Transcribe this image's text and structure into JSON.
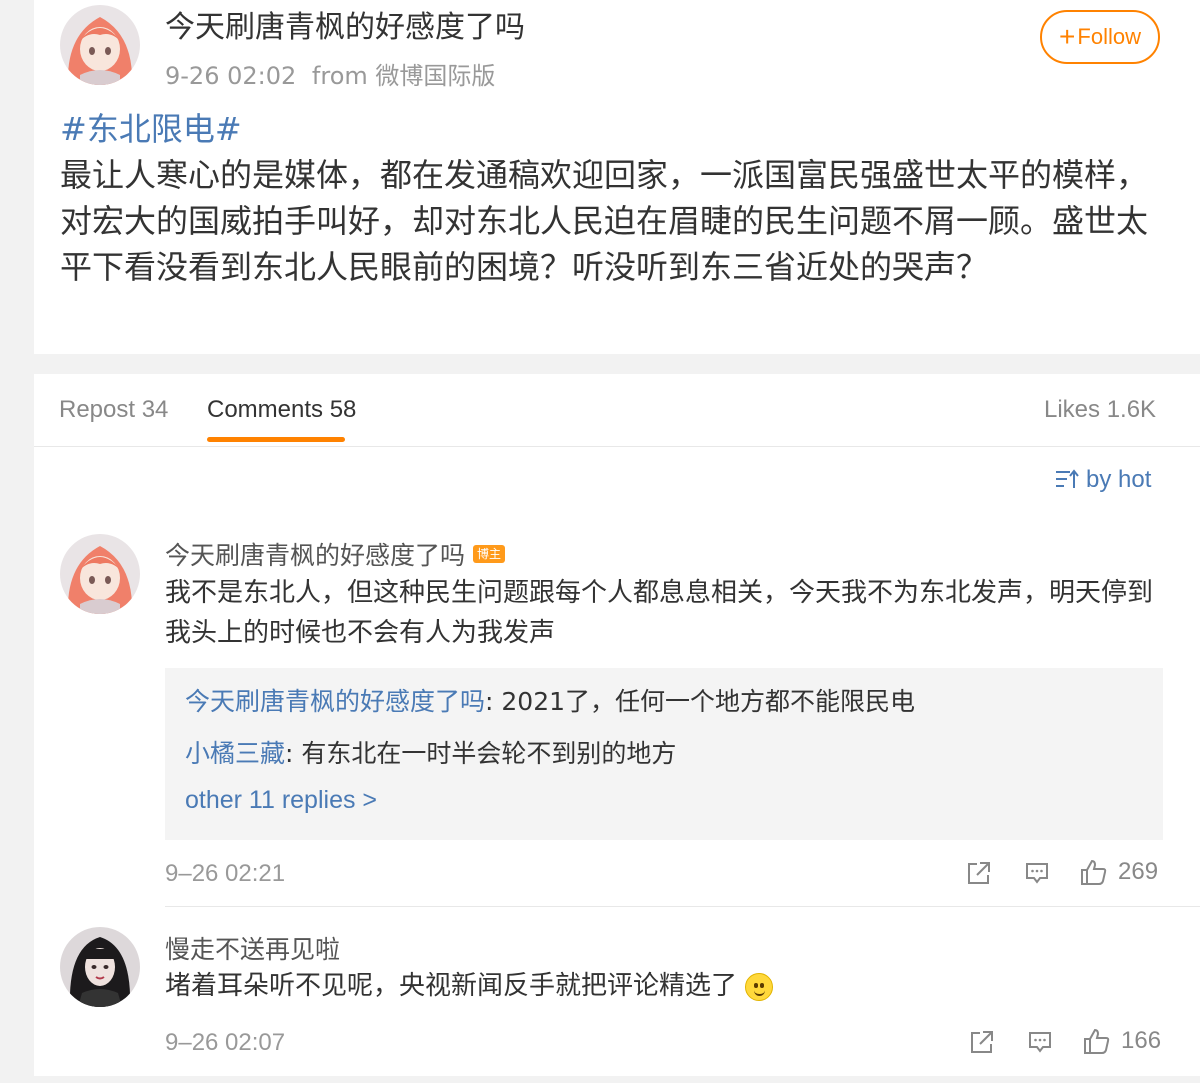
{
  "post": {
    "author": "今天刷唐青枫的好感度了吗",
    "time": "9-26 02:02",
    "source": "from 微博国际版",
    "follow_label": "Follow",
    "hashtag": "#东北限电#",
    "text": "最让人寒心的是媒体，都在发通稿欢迎回家，一派国富民强盛世太平的模样，对宏大的国威拍手叫好，却对东北人民迫在眉睫的民生问题不屑一顾。盛世太平下看没看到东北人民眼前的困境？听没听到东三省近处的哭声？"
  },
  "tabs": {
    "repost": "Repost 34",
    "comments": "Comments 58",
    "likes": "Likes 1.6K"
  },
  "sort_label": "by hot",
  "comments": [
    {
      "name": "今天刷唐青枫的好感度了吗",
      "badge": "博主",
      "text": "我不是东北人，但这种民生问题跟每个人都息息相关，今天我不为东北发声，明天停到我头上的时候也不会有人为我发声",
      "replies": [
        {
          "user": "今天刷唐青枫的好感度了吗",
          "text": ": 2021了，任何一个地方都不能限民电"
        },
        {
          "user": "小橘三藏",
          "text": ": 有东北在一时半会轮不到别的地方"
        }
      ],
      "more_replies": "other 11 replies >",
      "time": "9–26 02:21",
      "likes": "269"
    },
    {
      "name": "慢走不送再见啦",
      "text": "堵着耳朵听不见呢，央视新闻反手就把评论精选了",
      "time": "9–26 02:07",
      "likes": "166"
    }
  ],
  "icons": {
    "repost": "share-out-icon",
    "comment": "comment-icon",
    "like": "thumbs-up-icon",
    "sort": "sort-icon"
  },
  "colors": {
    "accent": "#ff8200",
    "link": "#4a7ab5"
  }
}
